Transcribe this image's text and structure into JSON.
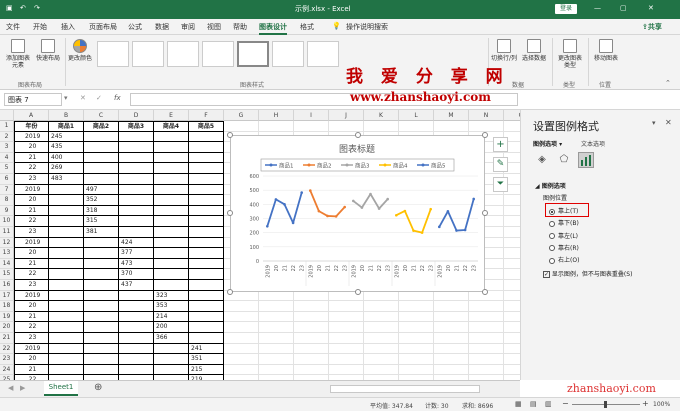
{
  "app": {
    "title": "示例.xlsx - Excel",
    "login": "登录",
    "share": "共享"
  },
  "tabs": [
    "文件",
    "开始",
    "插入",
    "页面布局",
    "公式",
    "数据",
    "审阅",
    "视图",
    "帮助",
    "图表设计",
    "格式"
  ],
  "tell_me": "操作说明搜索",
  "ribbon": {
    "add_element": "添加图表元素",
    "quick_layout": "快速布局",
    "change_color": "更改颜色",
    "switch_rowcol": "切换行/列",
    "select_data": "选择数据",
    "change_type": "更改图表类型",
    "move_chart": "移动图表",
    "groups": {
      "layout": "图表布局",
      "styles": "图表样式",
      "data": "数据",
      "type": "类型",
      "location": "位置"
    }
  },
  "namebox": "图表 7",
  "fx": "fx",
  "columns": [
    "A",
    "B",
    "C",
    "D",
    "E",
    "F",
    "G",
    "H",
    "I",
    "J",
    "K",
    "L",
    "M",
    "N",
    "O"
  ],
  "rows": [
    "1",
    "2",
    "3",
    "4",
    "5",
    "6",
    "7",
    "8",
    "9",
    "10",
    "11",
    "12",
    "13",
    "14",
    "15",
    "16",
    "17",
    "18",
    "19",
    "20",
    "21",
    "22",
    "23",
    "24",
    "25",
    "26",
    "27"
  ],
  "table": {
    "headers": [
      "年份",
      "商品1",
      "商品2",
      "商品3",
      "商品4",
      "商品5"
    ],
    "col_a": [
      "2019",
      "20",
      "21",
      "22",
      "23",
      "2019",
      "20",
      "21",
      "22",
      "23",
      "2019",
      "20",
      "21",
      "22",
      "23",
      "2019",
      "20",
      "21",
      "22",
      "23",
      "2019",
      "20",
      "21",
      "22",
      "23"
    ],
    "values": [
      {
        "col": 1,
        "start": 0,
        "data": [
          "245",
          "435",
          "400",
          "269",
          "483"
        ]
      },
      {
        "col": 2,
        "start": 5,
        "data": [
          "497",
          "352",
          "318",
          "315",
          "381"
        ]
      },
      {
        "col": 3,
        "start": 10,
        "data": [
          "424",
          "377",
          "473",
          "370",
          "437"
        ]
      },
      {
        "col": 4,
        "start": 15,
        "data": [
          "323",
          "353",
          "214",
          "200",
          "366"
        ]
      },
      {
        "col": 5,
        "start": 20,
        "data": [
          "241",
          "351",
          "215",
          "219",
          "438"
        ]
      }
    ]
  },
  "chart_data": {
    "type": "line",
    "title": "图表标题",
    "legend_position": "top",
    "ylim": [
      0,
      600
    ],
    "yticks": [
      "0",
      "100",
      "200",
      "300",
      "400",
      "500",
      "600"
    ],
    "categories": [
      "2019",
      "20",
      "21",
      "22",
      "23",
      "2019",
      "20",
      "21",
      "22",
      "23",
      "2019",
      "20",
      "21",
      "22",
      "23",
      "2019",
      "20",
      "21",
      "22",
      "23",
      "2019",
      "20",
      "21",
      "22",
      "23"
    ],
    "series": [
      {
        "name": "商品1",
        "color": "#4472C4",
        "offset": 0,
        "values": [
          245,
          435,
          400,
          269,
          483
        ]
      },
      {
        "name": "商品2",
        "color": "#ED7D31",
        "offset": 5,
        "values": [
          497,
          352,
          318,
          315,
          381
        ]
      },
      {
        "name": "商品3",
        "color": "#A5A5A5",
        "offset": 10,
        "values": [
          424,
          377,
          473,
          370,
          437
        ]
      },
      {
        "name": "商品4",
        "color": "#FFC000",
        "offset": 15,
        "values": [
          323,
          353,
          214,
          200,
          366
        ]
      },
      {
        "name": "商品5",
        "color": "#4472C4",
        "offset": 20,
        "values": [
          241,
          351,
          215,
          219,
          438
        ]
      }
    ]
  },
  "pane": {
    "title": "设置图例格式",
    "tab_legend": "图例选项",
    "tab_text": "文本选项",
    "section": "图例选项",
    "position_label": "图例位置",
    "options": [
      "靠上(T)",
      "靠下(B)",
      "靠左(L)",
      "靠右(R)",
      "右上(O)"
    ],
    "selected": 0,
    "overlap": "显示图例，但不与图表重叠(S)"
  },
  "sheet": "Sheet1",
  "status": {
    "average": "平均值: 347.84",
    "count": "计数: 30",
    "sum": "求和: 8696",
    "zoom": "100%"
  },
  "watermark": {
    "big": "我 爱 分 享 网",
    "url": "www.zhanshaoyi.com",
    "corner": "zhanshaoyi.com"
  }
}
